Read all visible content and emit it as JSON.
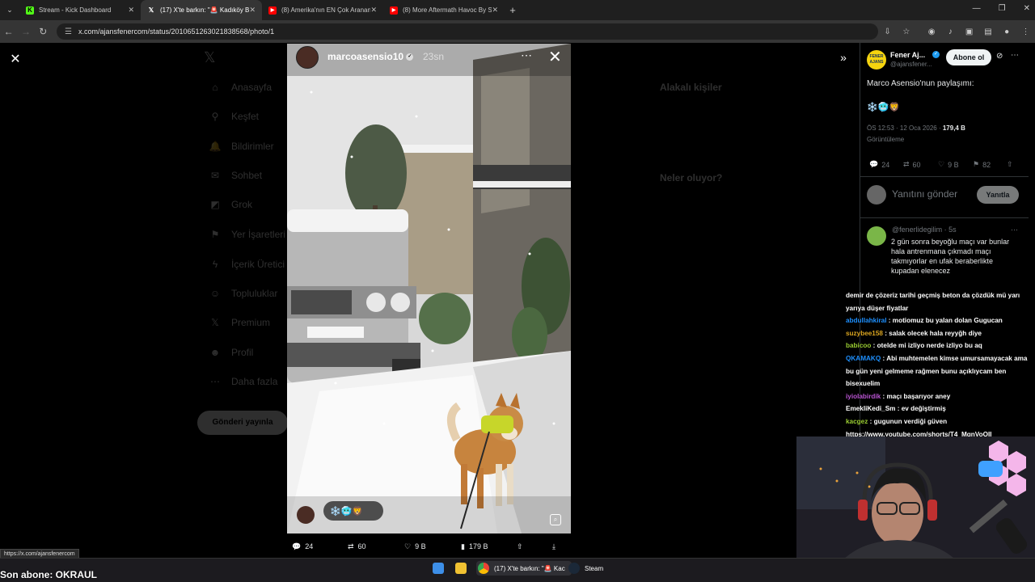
{
  "browser": {
    "tabs": [
      {
        "title": "Stream - Kick Dashboard",
        "icon": "kick-icon",
        "active": false
      },
      {
        "title": "(17) X'te barkın: \"🚨 Kadıköy B",
        "icon": "x-icon",
        "active": true
      },
      {
        "title": "(8) Amerika'nın EN Çok Aranan",
        "icon": "youtube-icon",
        "active": false
      },
      {
        "title": "(8) More Aftermath Havoc By S",
        "icon": "youtube-icon",
        "active": false
      }
    ],
    "url": "x.com/ajansfenercom/status/2010651263021838568/photo/1",
    "status_url": "https://x.com/ajansfenercom"
  },
  "background_nav": {
    "items": [
      {
        "label": "Anasayfa",
        "icon": "home-icon"
      },
      {
        "label": "Keşfet",
        "icon": "search-icon"
      },
      {
        "label": "Bildirimler",
        "icon": "bell-icon"
      },
      {
        "label": "Sohbet",
        "icon": "chat-icon"
      },
      {
        "label": "Grok",
        "icon": "grok-icon"
      },
      {
        "label": "Yer İşaretleri",
        "icon": "bookmark-icon"
      },
      {
        "label": "İçerik Üretici",
        "icon": "bolt-icon"
      },
      {
        "label": "Topluluklar",
        "icon": "people-icon"
      },
      {
        "label": "Premium",
        "icon": "x-icon"
      },
      {
        "label": "Profil",
        "icon": "person-icon"
      },
      {
        "label": "Daha fazla",
        "icon": "more-icon"
      }
    ],
    "post_button": "Gönderi yayınla"
  },
  "story": {
    "username": "marcoasensio10",
    "time": "23sn",
    "reactions": "❄️🥶🦁"
  },
  "photo_actions": {
    "replies": "24",
    "reposts": "60",
    "likes": "9 B",
    "views": "179 B"
  },
  "tweet": {
    "account_name": "Fener Aj...",
    "account_handle": "@ajansfener...",
    "follow_label": "Abone ol",
    "text": "Marco Asensio'nun paylaşımı:",
    "emoji": "❄️🥶🦁",
    "time": "ÖS 12:53 · 12 Oca 2026 ·",
    "views": "179,4 B",
    "views_label": "Görüntüleme",
    "stats": {
      "replies": "24",
      "reposts": "60",
      "likes": "9 B",
      "bookmarks": "82"
    },
    "reply_placeholder": "Yanıtını gönder",
    "reply_button": "Yanıtla",
    "avatar_text": "FENER AJANS"
  },
  "comment": {
    "handle": "@fenerlidegilim · 5s",
    "text": "2 gün sonra beyoğlu maçı var bunlar hala antrenmana çıkmadı maçı takmıyorlar en ufak beraberlikte kupadan elenecez"
  },
  "chat": [
    {
      "user": "",
      "text": "demir de çözeriz tarihi geçmiş beton da çözdük mü yarı yarıya düşer fiyatlar",
      "color": "#ffffff"
    },
    {
      "user": "abdullahkiral",
      "text": ": motiomuz bu yalan dolan Gugucan",
      "color": "#1e90ff"
    },
    {
      "user": "suzybee158",
      "text": ": salak olecek hala reyyğh diye",
      "color": "#daa520"
    },
    {
      "user": "babicoo",
      "text": ": otelde mi izliyo nerde izliyo bu aq",
      "color": "#9acd32"
    },
    {
      "user": "QKAMAKQ",
      "text": ": Abi muhtemelen kimse umursamayacak ama bu gün yeni gelmeme rağmen bunu açıklıycam ben bisexuelim",
      "color": "#1e90ff"
    },
    {
      "user": "iyiolabirdik",
      "text": ": maçı başarıyor aney",
      "color": "#ba55d3"
    },
    {
      "user": "EmekliKedi_Sm",
      "text": ": ev değiştirmiş",
      "color": "#ffffff"
    },
    {
      "user": "kacgez",
      "text": ": gugunun verdiği güven https://www.youtube.com/shorts/T4_MqnVoOII",
      "color": "#9acd32"
    }
  ],
  "overlay": {
    "son_abone": "Son abone: OKRAUL"
  },
  "taskbar": {
    "chrome_label": "(17) X'te barkın: \"🚨 Kac",
    "steam_label": "Steam"
  }
}
